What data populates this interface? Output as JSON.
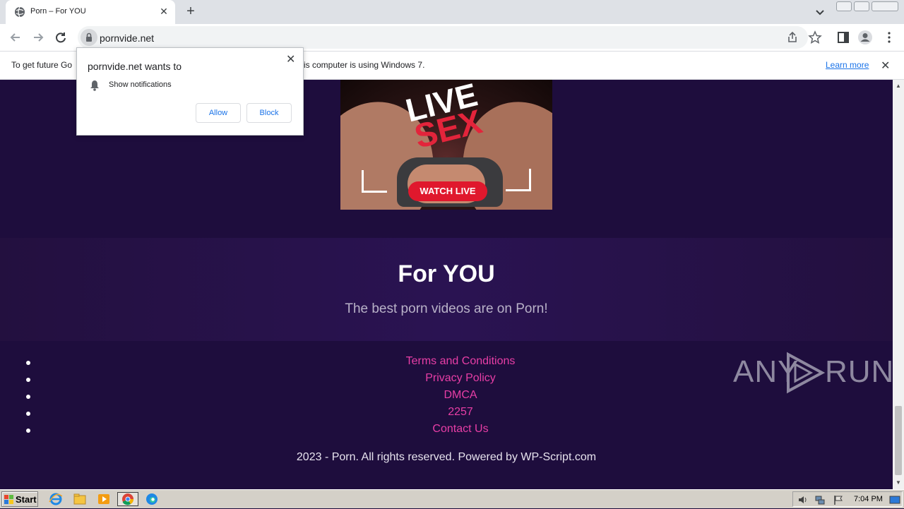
{
  "browser": {
    "tab": {
      "title": "Porn – For YOU",
      "close": "✕"
    },
    "new_tab": "+",
    "url": "pornvide.net",
    "infobar": {
      "message_left": "To get future Go",
      "message_right": "is computer is using Windows 7.",
      "learn_more": "Learn more",
      "close": "✕"
    }
  },
  "permission_popup": {
    "title": "pornvide.net wants to",
    "item": "Show notifications",
    "allow": "Allow",
    "block": "Block",
    "close": "✕"
  },
  "ad_banner": {
    "line1": "LIVE",
    "line2": "SEX",
    "cta": "WATCH LIVE"
  },
  "hero": {
    "title": "For YOU",
    "subtitle": "The best porn videos are on Porn!"
  },
  "footer": {
    "links": [
      "Terms and Conditions",
      "Privacy Policy",
      "DMCA",
      "2257",
      "Contact Us"
    ],
    "copyright": "2023 - Porn. All rights reserved. Powered by WP-Script.com"
  },
  "watermark": {
    "left": "ANY",
    "right": "RUN"
  },
  "taskbar": {
    "start": "Start",
    "time": "7:04 PM",
    "apps": [
      "internet-explorer-icon",
      "file-explorer-icon",
      "media-player-icon",
      "chrome-icon",
      "edge-icon"
    ]
  },
  "colors": {
    "page_bg": "#1e0d3d",
    "link_pink": "#e83ea6",
    "cta_red": "#e0182d"
  }
}
